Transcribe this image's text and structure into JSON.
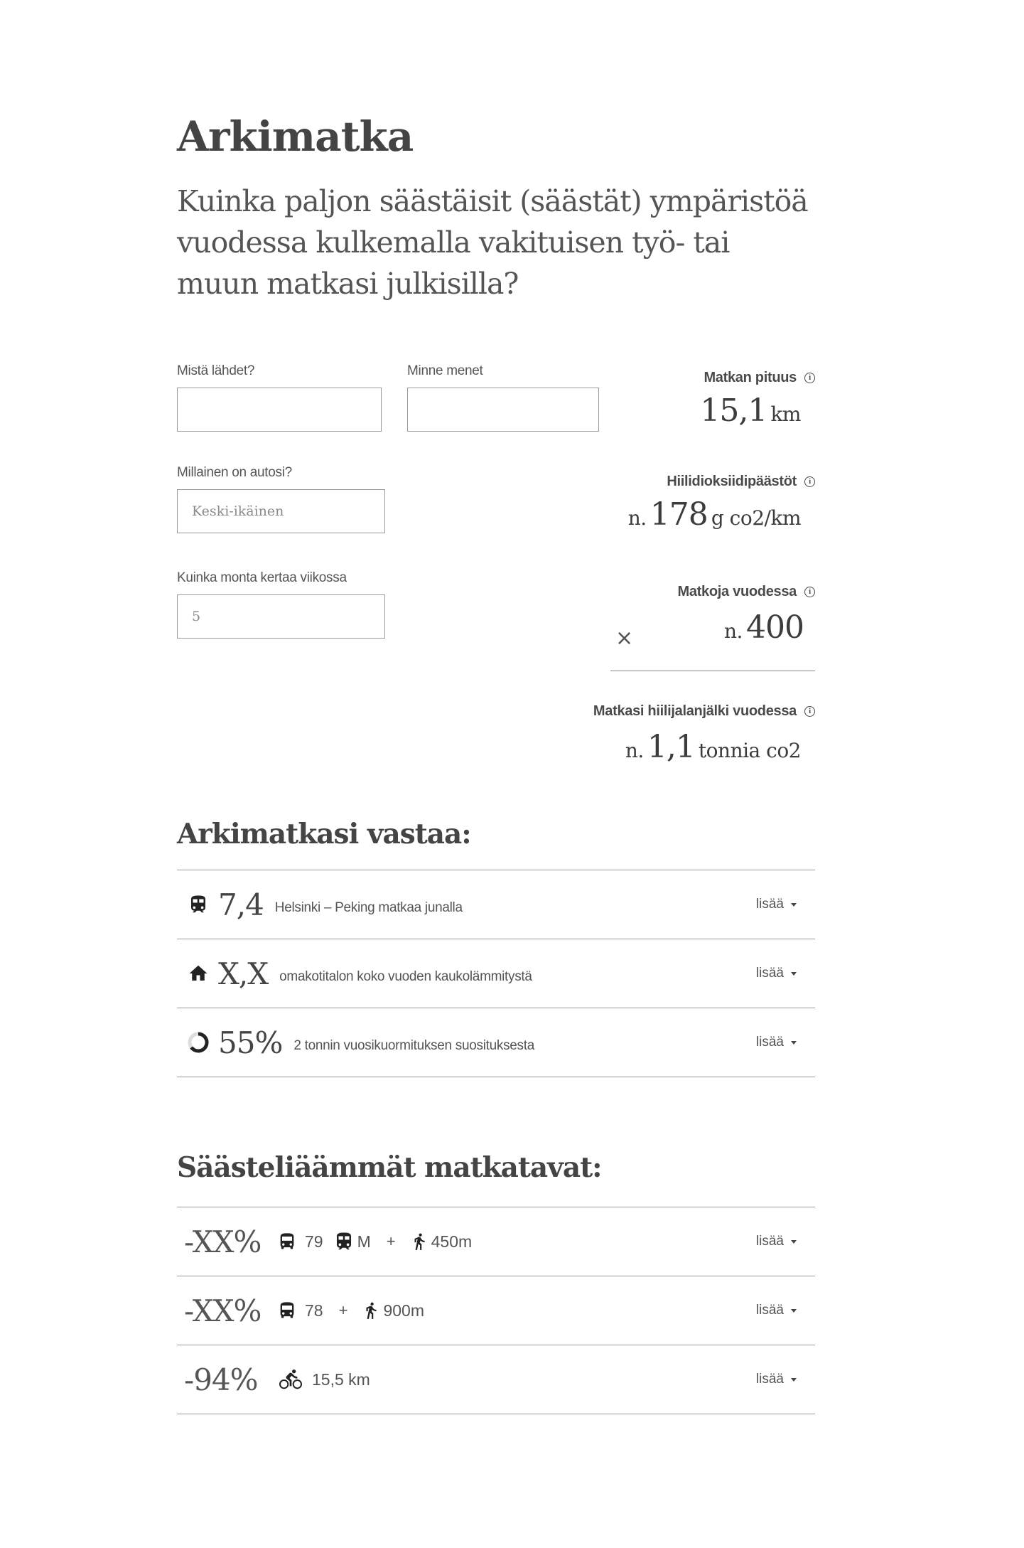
{
  "title": "Arkimatka",
  "subtitle": "Kuinka paljon säästäisit (säästät) ympäristöä vuodessa kulkemalla vakituisen työ- tai muun matkasi julkisilla?",
  "form": {
    "from_label": "Mistä lähdet?",
    "from_value": "",
    "to_label": "Minne menet",
    "to_value": "",
    "car_label": "Millainen on autosi?",
    "car_placeholder": "Keski-ikäinen",
    "times_label": "Kuinka monta kertaa viikossa",
    "times_placeholder": "5"
  },
  "stats": {
    "length": {
      "label": "Matkan pituus",
      "value": "15,1",
      "unit": "km"
    },
    "emissions": {
      "label": "Hiilidioksiidipäästöt",
      "prefix": "n.",
      "value": "178",
      "unit": "g co2/km"
    },
    "trips": {
      "label": "Matkoja vuodessa",
      "prefix": "n.",
      "value": "400",
      "operator": "×"
    },
    "footprint": {
      "label": "Matkasi hiilijalanjälki vuodessa",
      "prefix": "n.",
      "value": "1,1",
      "unit": "tonnia co2"
    }
  },
  "equivalents": {
    "title": "Arkimatkasi vastaa:",
    "items": [
      {
        "icon": "train-icon",
        "value": "7,4",
        "text": "Helsinki – Peking  matkaa junalla",
        "more": "lisää"
      },
      {
        "icon": "house-icon",
        "value": "X,X",
        "text": "omakotitalon koko vuoden kaukolämmitystä",
        "more": "lisää"
      },
      {
        "icon": "donut-chart-icon",
        "value": "55%",
        "text": "2 tonnin vuosikuormituksen suosituksesta",
        "more": "lisää"
      }
    ]
  },
  "alternatives": {
    "title": "Säästeliäämmät matkatavat:",
    "items": [
      {
        "pct": "-XX%",
        "bus1": "79",
        "metro": "M",
        "plus": "+",
        "walk": "450m",
        "more": "lisää"
      },
      {
        "pct": "-XX%",
        "bus": "78",
        "plus": "+",
        "walk": "900m",
        "more": "lisää"
      },
      {
        "pct": "-94%",
        "bike": "15,5 km",
        "more": "lisää"
      }
    ]
  },
  "colors": {
    "text": "#444444",
    "border": "#9a9a9a",
    "background": "#ffffff"
  }
}
